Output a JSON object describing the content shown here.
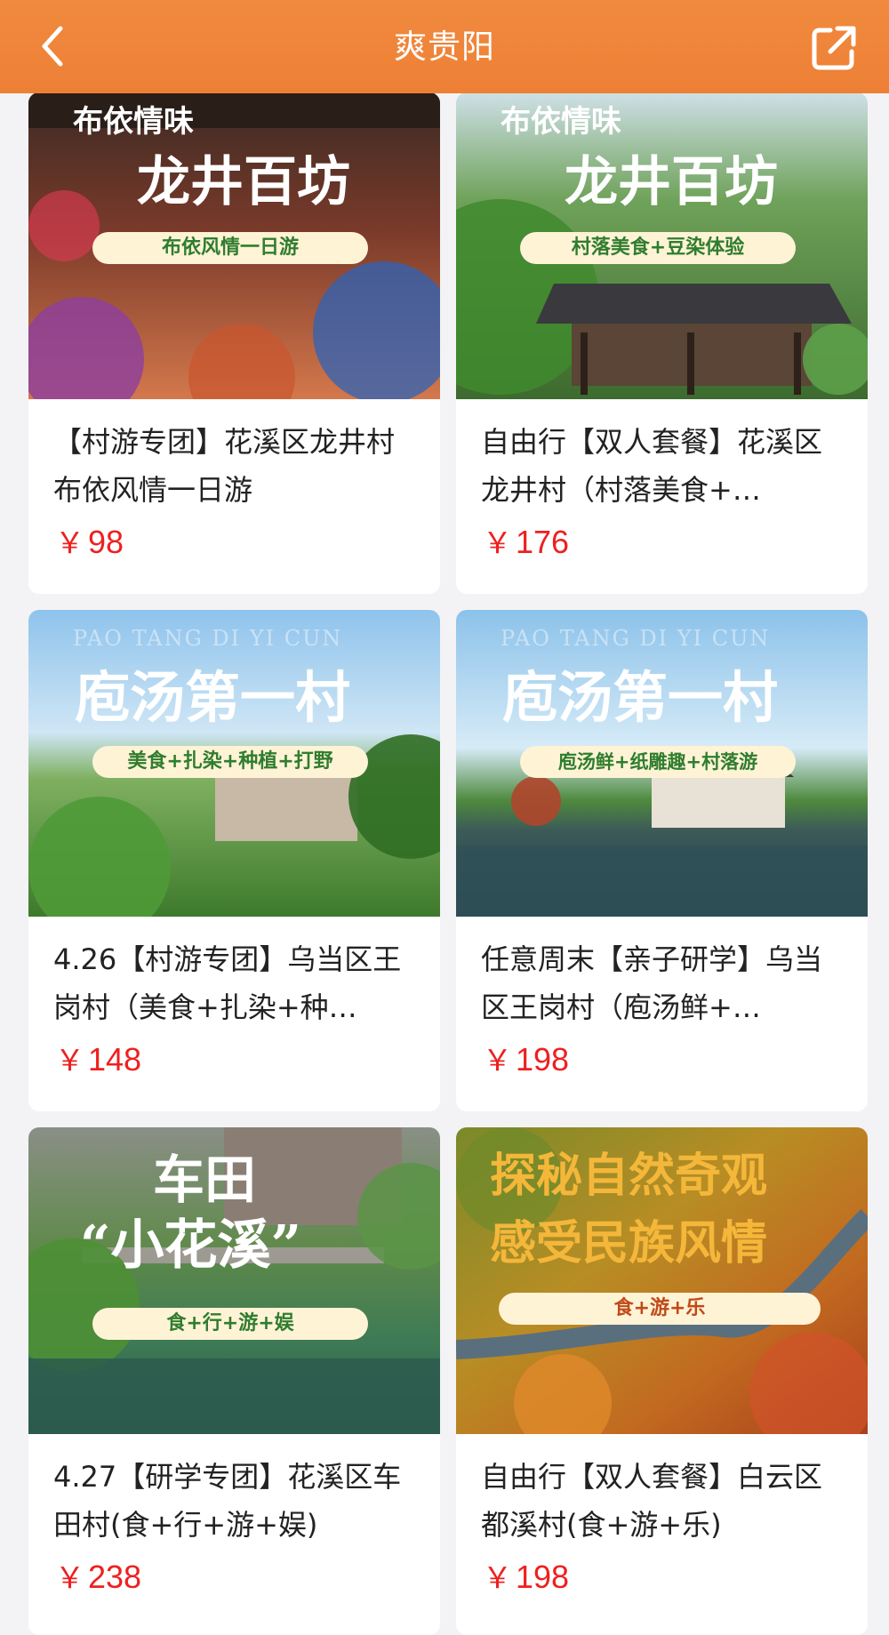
{
  "header": {
    "title": "爽贵阳",
    "back_icon": "chevron-left-icon",
    "share_icon": "share-external-icon",
    "bg_color": "#ef853a"
  },
  "currency": "￥",
  "products": [
    {
      "name": "【村游专团】花溪区龙井村布依风情一日游",
      "price": "98",
      "image": {
        "top_tag": "布依情味",
        "headline": "龙井百坊",
        "ribbon": "布依风情一日游"
      }
    },
    {
      "name": "自由行【双人套餐】花溪区龙井村（村落美食+…",
      "price": "176",
      "image": {
        "top_tag": "布依情味",
        "headline": "龙井百坊",
        "ribbon": "村落美食+豆染体验"
      }
    },
    {
      "name": "4.26【村游专团】乌当区王岗村（美食+扎染+种…",
      "price": "148",
      "image": {
        "top_tag": "PAO TANG DI YI CUN",
        "headline": "庖汤第一村",
        "ribbon": "美食+扎染+种植+打野"
      }
    },
    {
      "name": "任意周末【亲子研学】乌当区王岗村（庖汤鲜+…",
      "price": "198",
      "image": {
        "top_tag": "PAO TANG DI YI CUN",
        "headline": "庖汤第一村",
        "ribbon": "庖汤鲜+纸雕趣+村落游"
      }
    },
    {
      "name": "4.27【研学专团】花溪区车田村(食+行+游+娱)",
      "price": "238",
      "image": {
        "top_tag": "车田",
        "headline": "“小花溪”",
        "ribbon": "食+行+游+娱"
      }
    },
    {
      "name": "自由行【双人套餐】白云区都溪村(食+游+乐)",
      "price": "198",
      "image": {
        "top_tag": "探秘自然奇观",
        "headline": "感受民族风情",
        "ribbon": "食+游+乐"
      }
    }
  ],
  "colors": {
    "price": "#ee2020",
    "ribbon_bg": "#fff3d6",
    "ribbon_text": "#2f7d2f"
  }
}
